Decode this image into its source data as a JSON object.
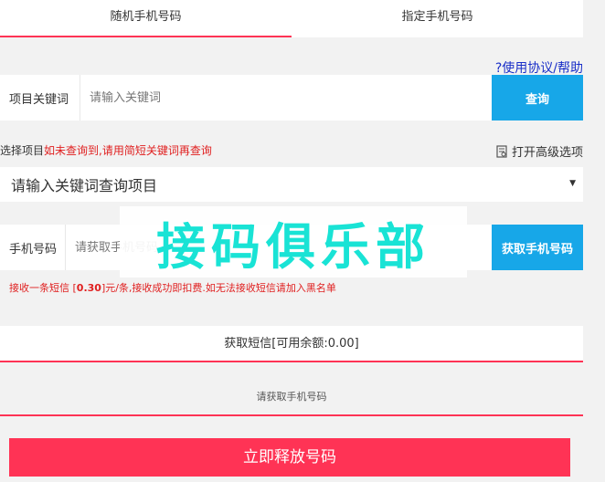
{
  "tabs": [
    {
      "label": "随机手机号码",
      "active": true
    },
    {
      "label": "指定手机号码",
      "active": false
    }
  ],
  "help_link": "?使用协议/帮助",
  "keyword_row": {
    "label": "项目关键词",
    "placeholder": "请输入关键词",
    "button": "查询"
  },
  "select_hint": {
    "prefix": "选择项目",
    "warning": "如未查询到,请用简短关键词再查询"
  },
  "advanced_options": "打开高级选项",
  "project_select": {
    "selected": "请输入关键词查询项目"
  },
  "phone_row": {
    "label": "手机号码",
    "placeholder": "请获取手机号码",
    "button": "获取手机号码"
  },
  "notice": {
    "before": "接收一条短信 [",
    "price": "0.30",
    "after": "]元/条,接收成功即扣费.如无法接收短信请加入黑名单"
  },
  "get_sms_button": "获取短信[可用余额:0.00]",
  "sms_placeholder": "请获取手机号码",
  "release_button": "立即释放号码",
  "watermark": "接码俱乐部",
  "colors": {
    "accent": "#ff3355",
    "button_blue": "#17a7e8",
    "warning": "#e02020",
    "link": "#1a2fc8",
    "watermark": "#19e3d5"
  }
}
